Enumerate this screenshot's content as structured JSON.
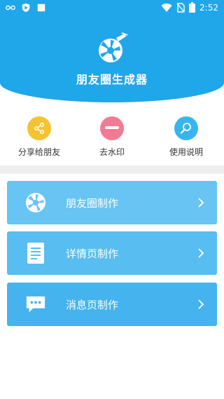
{
  "status_bar": {
    "time": "2:52",
    "icons": [
      "infinity-icon",
      "shield-icon",
      "square-icon",
      "wifi-icon",
      "no-sim-icon",
      "battery-icon"
    ]
  },
  "header": {
    "title": "朋友圈生成器",
    "logo_icon": "aperture-pen-icon",
    "background_color": "#1fa7ea"
  },
  "quick_actions": [
    {
      "label": "分享给朋友",
      "icon": "share-icon",
      "color": "#f5c330"
    },
    {
      "label": "去水印",
      "icon": "minus-icon",
      "color": "#f27b93"
    },
    {
      "label": "使用说明",
      "icon": "search-icon",
      "color": "#38b5ee"
    }
  ],
  "menu_cards": [
    {
      "label": "朋友圈制作",
      "icon": "aperture-icon",
      "color": "#67c4f3"
    },
    {
      "label": "详情页制作",
      "icon": "document-icon",
      "color": "#58bdf1"
    },
    {
      "label": "消息页制作",
      "icon": "chat-icon",
      "color": "#44b3ee"
    }
  ]
}
